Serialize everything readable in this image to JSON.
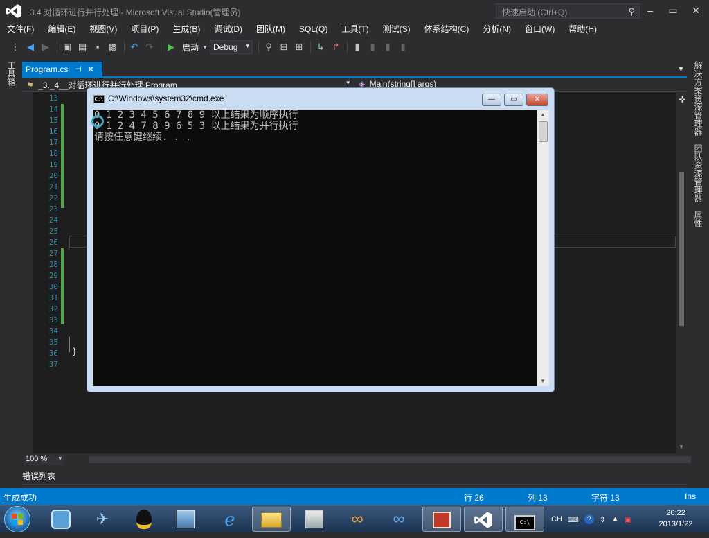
{
  "window": {
    "title": "3.4 对循环进行并行处理 - Microsoft Visual Studio(管理员)",
    "quick_launch_placeholder": "快速启动 (Ctrl+Q)",
    "minimize": "–",
    "restore": "▭",
    "close": "✕"
  },
  "menu": [
    "文件(F)",
    "编辑(E)",
    "视图(V)",
    "项目(P)",
    "生成(B)",
    "调试(D)",
    "团队(M)",
    "SQL(Q)",
    "工具(T)",
    "测试(S)",
    "体系结构(C)",
    "分析(N)",
    "窗口(W)",
    "帮助(H)"
  ],
  "toolbar": {
    "start_label": "启动",
    "config": "Debug"
  },
  "side_tabs": {
    "toolbox": "工具箱",
    "solution_explorer": "解决方案资源管理器",
    "team_explorer": "团队资源管理器",
    "properties": "属性"
  },
  "document": {
    "tab_label": "Program.cs",
    "pin_glyph": "⊣",
    "close_glyph": "✕",
    "nav_left": "_3._4__对循环进行并行处理.Program",
    "nav_right": "Main(string[] args)"
  },
  "editor": {
    "line_numbers": [
      "13",
      "14",
      "15",
      "16",
      "17",
      "18",
      "19",
      "20",
      "21",
      "22",
      "23",
      "24",
      "25",
      "26",
      "27",
      "28",
      "29",
      "30",
      "31",
      "32",
      "33",
      "34",
      "35",
      "36",
      "37"
    ],
    "closing_brace": "}",
    "zoom": "100 %"
  },
  "error_list": {
    "label": "错误列表"
  },
  "status": {
    "message": "生成成功",
    "row": "行 26",
    "col": "列 13",
    "char": "字符 13",
    "mode": "Ins"
  },
  "cmd": {
    "title": "C:\\Windows\\system32\\cmd.exe",
    "icon_text": "C:\\",
    "lines": [
      "0 1 2 3 4 5 6 7 8 9 以上结果为顺序执行",
      "0 1 2 4 7 8 9 6 5 3 以上结果为并行执行",
      "请按任意键继续. . ."
    ]
  },
  "taskbar": {
    "lang": "CH",
    "time": "20:22",
    "date": "2013/1/22"
  }
}
